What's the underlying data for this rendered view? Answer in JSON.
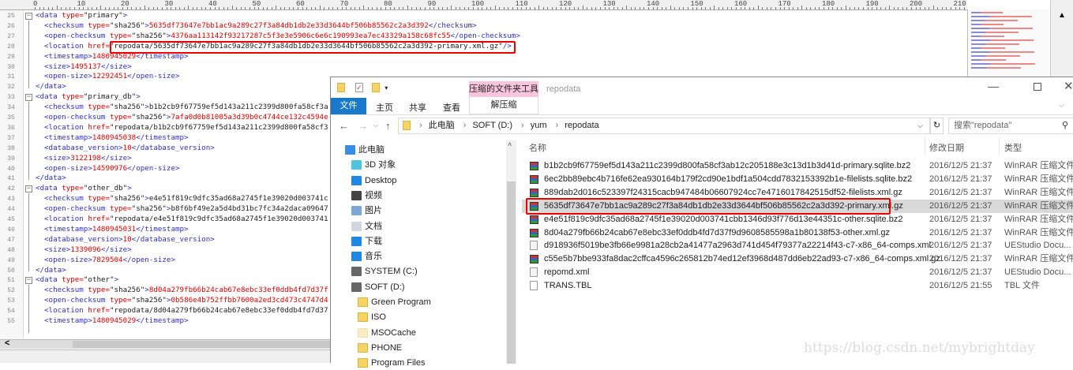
{
  "editor": {
    "ruler": [
      "0",
      "10",
      "20",
      "30",
      "40",
      "50",
      "60",
      "70",
      "80",
      "90",
      "100",
      "110",
      "120",
      "130",
      "140",
      "150",
      "160",
      "170",
      "180",
      "190",
      "200",
      "210"
    ],
    "lines": [
      {
        "n": "25",
        "i": 0,
        "t": [
          [
            "<data",
            "tag"
          ],
          [
            " type=",
            "attr"
          ],
          [
            "\"primary\"",
            "str"
          ],
          [
            ">",
            "tag"
          ]
        ]
      },
      {
        "n": "26",
        "i": 1,
        "t": [
          [
            "<checksum",
            "tag"
          ],
          [
            " type=",
            "attr"
          ],
          [
            "\"sha256\"",
            "str"
          ],
          [
            ">",
            "tag"
          ],
          [
            "5635df73647e7bb1ac9a289c27f3a84db1db2e33d3644bf506b85562c2a3d392",
            "val"
          ],
          [
            "</checksum>",
            "tag"
          ]
        ]
      },
      {
        "n": "27",
        "i": 1,
        "t": [
          [
            "<open-checksum",
            "tag"
          ],
          [
            " type=",
            "attr"
          ],
          [
            "\"sha256\"",
            "str"
          ],
          [
            ">",
            "tag"
          ],
          [
            "4376aa113142f93217287c5f3e3e5906c6e6c190993ea7ec43329a158c68fc55",
            "val"
          ],
          [
            "</open-checksum>",
            "tag"
          ]
        ]
      },
      {
        "n": "28",
        "i": 1,
        "t": [
          [
            "<location",
            "tag"
          ],
          [
            " href=",
            "attr"
          ],
          [
            "\"repodata/5635df73647e7bb1ac9a289c27f3a84db1db2e33d3644bf506b85562c2a3d392-primary.xml.gz\"",
            "str"
          ],
          [
            "/>",
            "tag"
          ]
        ]
      },
      {
        "n": "29",
        "i": 1,
        "t": [
          [
            "<timestamp>",
            "tag"
          ],
          [
            "1480945029",
            "val"
          ],
          [
            "</timestamp>",
            "tag"
          ]
        ]
      },
      {
        "n": "30",
        "i": 1,
        "t": [
          [
            "<size>",
            "tag"
          ],
          [
            "1495137",
            "val"
          ],
          [
            "</size>",
            "tag"
          ]
        ]
      },
      {
        "n": "31",
        "i": 1,
        "t": [
          [
            "<open-size>",
            "tag"
          ],
          [
            "12292451",
            "val"
          ],
          [
            "</open-size>",
            "tag"
          ]
        ]
      },
      {
        "n": "32",
        "i": 0,
        "t": [
          [
            "</data>",
            "tag"
          ]
        ]
      },
      {
        "n": "33",
        "i": 0,
        "t": [
          [
            "<data",
            "tag"
          ],
          [
            " type=",
            "attr"
          ],
          [
            "\"primary_db\"",
            "str"
          ],
          [
            ">",
            "tag"
          ]
        ]
      },
      {
        "n": "34",
        "i": 1,
        "t": [
          [
            "<checksum",
            "tag"
          ],
          [
            " type=",
            "attr"
          ],
          [
            "\"sha256\"",
            "str"
          ],
          [
            ">",
            "tag"
          ],
          [
            "b1b2cb9f67759ef5d143a211c2399d800fa58cf3a",
            "str"
          ]
        ]
      },
      {
        "n": "35",
        "i": 1,
        "t": [
          [
            "<open-checksum",
            "tag"
          ],
          [
            " type=",
            "attr"
          ],
          [
            "\"sha256\"",
            "str"
          ],
          [
            ">",
            "tag"
          ],
          [
            "7afa0d0b81005a3d39b0c4744ce132c4594e",
            "val"
          ]
        ]
      },
      {
        "n": "36",
        "i": 1,
        "t": [
          [
            "<location",
            "tag"
          ],
          [
            " href=",
            "attr"
          ],
          [
            "\"repodata/b1b2cb9f67759ef5d143a211c2399d800fa58cf3",
            "str"
          ]
        ]
      },
      {
        "n": "37",
        "i": 1,
        "t": [
          [
            "<timestamp>",
            "tag"
          ],
          [
            "1480945038",
            "val"
          ],
          [
            "</timestamp>",
            "tag"
          ]
        ]
      },
      {
        "n": "38",
        "i": 1,
        "t": [
          [
            "<database_version>",
            "tag"
          ],
          [
            "10",
            "val"
          ],
          [
            "</database_version>",
            "tag"
          ]
        ]
      },
      {
        "n": "39",
        "i": 1,
        "t": [
          [
            "<size>",
            "tag"
          ],
          [
            "3122198",
            "val"
          ],
          [
            "</size>",
            "tag"
          ]
        ]
      },
      {
        "n": "40",
        "i": 1,
        "t": [
          [
            "<open-size>",
            "tag"
          ],
          [
            "14590976",
            "val"
          ],
          [
            "</open-size>",
            "tag"
          ]
        ]
      },
      {
        "n": "41",
        "i": 0,
        "t": [
          [
            "</data>",
            "tag"
          ]
        ]
      },
      {
        "n": "42",
        "i": 0,
        "t": [
          [
            "<data",
            "tag"
          ],
          [
            " type=",
            "attr"
          ],
          [
            "\"other_db\"",
            "str"
          ],
          [
            ">",
            "tag"
          ]
        ]
      },
      {
        "n": "43",
        "i": 1,
        "t": [
          [
            "<checksum",
            "tag"
          ],
          [
            " type=",
            "attr"
          ],
          [
            "\"sha256\"",
            "str"
          ],
          [
            ">",
            "tag"
          ],
          [
            "e4e51f819c9dfc35ad68a2745f1e39020d003741c",
            "str"
          ]
        ]
      },
      {
        "n": "44",
        "i": 1,
        "t": [
          [
            "<open-checksum",
            "tag"
          ],
          [
            " type=",
            "attr"
          ],
          [
            "\"sha256\"",
            "str"
          ],
          [
            ">",
            "tag"
          ],
          [
            "b8f6bf49e2a5d4bd31bc7fc34a2daca09647",
            "str"
          ]
        ]
      },
      {
        "n": "45",
        "i": 1,
        "t": [
          [
            "<location",
            "tag"
          ],
          [
            " href=",
            "attr"
          ],
          [
            "\"repodata/e4e51f819c9dfc35ad68a2745f1e39020d003741",
            "str"
          ]
        ]
      },
      {
        "n": "46",
        "i": 1,
        "t": [
          [
            "<timestamp>",
            "tag"
          ],
          [
            "1480945031",
            "val"
          ],
          [
            "</timestamp>",
            "tag"
          ]
        ]
      },
      {
        "n": "47",
        "i": 1,
        "t": [
          [
            "<database_version>",
            "tag"
          ],
          [
            "10",
            "val"
          ],
          [
            "</database_version>",
            "tag"
          ]
        ]
      },
      {
        "n": "48",
        "i": 1,
        "t": [
          [
            "<size>",
            "tag"
          ],
          [
            "1339096",
            "val"
          ],
          [
            "</size>",
            "tag"
          ]
        ]
      },
      {
        "n": "49",
        "i": 1,
        "t": [
          [
            "<open-size>",
            "tag"
          ],
          [
            "7829504",
            "val"
          ],
          [
            "</open-size>",
            "tag"
          ]
        ]
      },
      {
        "n": "50",
        "i": 0,
        "t": [
          [
            "</data>",
            "tag"
          ]
        ]
      },
      {
        "n": "51",
        "i": 0,
        "t": [
          [
            "<data",
            "tag"
          ],
          [
            " type=",
            "attr"
          ],
          [
            "\"other\"",
            "str"
          ],
          [
            ">",
            "tag"
          ]
        ]
      },
      {
        "n": "52",
        "i": 1,
        "t": [
          [
            "<checksum",
            "tag"
          ],
          [
            " type=",
            "attr"
          ],
          [
            "\"sha256\"",
            "str"
          ],
          [
            ">",
            "tag"
          ],
          [
            "8d04a279fb66b24cab67e8ebc33ef0ddb4fd7d37f",
            "val"
          ]
        ]
      },
      {
        "n": "53",
        "i": 1,
        "t": [
          [
            "<open-checksum",
            "tag"
          ],
          [
            " type=",
            "attr"
          ],
          [
            "\"sha256\"",
            "str"
          ],
          [
            ">",
            "tag"
          ],
          [
            "0b586e4b752ffbb7600a2ed3cd473c4747d4",
            "val"
          ]
        ]
      },
      {
        "n": "54",
        "i": 1,
        "t": [
          [
            "<location",
            "tag"
          ],
          [
            " href=",
            "attr"
          ],
          [
            "\"repodata/8d04a279fb66b24cab67e8ebc33ef0ddb4fd7d37",
            "str"
          ]
        ]
      },
      {
        "n": "55",
        "i": 1,
        "t": [
          [
            "<timestamp>",
            "tag"
          ],
          [
            "1480945029",
            "val"
          ],
          [
            "</timestamp>",
            "tag"
          ]
        ]
      }
    ],
    "scroll_left": "<"
  },
  "explorer": {
    "title": "repodata",
    "context_tab": "压缩的文件夹工具",
    "tabs": [
      "文件",
      "主页",
      "共享",
      "查看"
    ],
    "context_sub_tab": "解压缩",
    "breadcrumb": [
      "此电脑",
      "SOFT (D:)",
      "yum",
      "repodata"
    ],
    "search_placeholder": "搜索\"repodata\"",
    "nav": [
      {
        "label": "此电脑",
        "icon": "pc",
        "lvl": 0
      },
      {
        "label": "3D 对象",
        "icon": "3d",
        "lvl": 1
      },
      {
        "label": "Desktop",
        "icon": "desktop",
        "lvl": 1
      },
      {
        "label": "视频",
        "icon": "video",
        "lvl": 1
      },
      {
        "label": "图片",
        "icon": "picture",
        "lvl": 1
      },
      {
        "label": "文档",
        "icon": "document",
        "lvl": 1
      },
      {
        "label": "下载",
        "icon": "download",
        "lvl": 1
      },
      {
        "label": "音乐",
        "icon": "music",
        "lvl": 1
      },
      {
        "label": "SYSTEM (C:)",
        "icon": "drive",
        "lvl": 1
      },
      {
        "label": "SOFT (D:)",
        "icon": "drive",
        "lvl": 1
      },
      {
        "label": "Green Program",
        "icon": "folder",
        "lvl": 2
      },
      {
        "label": "ISO",
        "icon": "folder",
        "lvl": 2
      },
      {
        "label": "MSOCache",
        "icon": "folder",
        "lvl": 2
      },
      {
        "label": "PHONE",
        "icon": "folder",
        "lvl": 2
      },
      {
        "label": "Program Files",
        "icon": "folder",
        "lvl": 2
      }
    ],
    "columns": {
      "name": "名称",
      "date": "修改日期",
      "type": "类型"
    },
    "files": [
      {
        "name": "b1b2cb9f67759ef5d143a211c2399d800fa58cf3ab12c205188e3c13d1b3d41d-primary.sqlite.bz2",
        "date": "2016/12/5 21:37",
        "type": "WinRAR 压缩文件",
        "icon": "rar"
      },
      {
        "name": "6ec2bb89ebc4b716fe62ea930164b179f2cd90e1bdf1a504cdd7832153392b1e-filelists.sqlite.bz2",
        "date": "2016/12/5 21:37",
        "type": "WinRAR 压缩文件",
        "icon": "rar"
      },
      {
        "name": "889dab2d016c523397f24315cacb947484b06607924cc7e4716017842515df52-filelists.xml.gz",
        "date": "2016/12/5 21:37",
        "type": "WinRAR 压缩文件",
        "icon": "rar"
      },
      {
        "name": "5635df73647e7bb1ac9a289c27f3a84db1db2e33d3644bf506b85562c2a3d392-primary.xml.gz",
        "date": "2016/12/5 21:37",
        "type": "WinRAR 压缩文件",
        "icon": "rar",
        "selected": true
      },
      {
        "name": "e4e51f819c9dfc35ad68a2745f1e39020d003741cbb1346d93f776d13e44351c-other.sqlite.bz2",
        "date": "2016/12/5 21:37",
        "type": "WinRAR 压缩文件",
        "icon": "rar"
      },
      {
        "name": "8d04a279fb66b24cab67e8ebc33ef0ddb4fd7d37f9d9608585598a1b80138f53-other.xml.gz",
        "date": "2016/12/5 21:37",
        "type": "WinRAR 压缩文件",
        "icon": "rar"
      },
      {
        "name": "d918936f5019be3fb66e9981a28cb2a41477a2963d741d454f79377a22214f43-c7-x86_64-comps.xml",
        "date": "2016/12/5 21:37",
        "type": "UEStudio Docu...",
        "icon": "xml"
      },
      {
        "name": "c55e5b7bbe933fa8dac2cffca4596c265812b74ed12ef3968d487dd6eb22ad93-c7-x86_64-comps.xml.gz",
        "date": "2016/12/5 21:37",
        "type": "WinRAR 压缩文件",
        "icon": "rar"
      },
      {
        "name": "repomd.xml",
        "date": "2016/12/5 21:37",
        "type": "UEStudio Docu...",
        "icon": "xml"
      },
      {
        "name": "TRANS.TBL",
        "date": "2016/12/5 21:55",
        "type": "TBL 文件",
        "icon": "doc"
      }
    ]
  },
  "watermark": "https://blog.csdn.net/mybrightday",
  "colors": {
    "tag": "#3030c8",
    "attr": "#e00000",
    "highlight": "#e00000",
    "file_tab": "#1979ca",
    "context_tab": "#f9c5dc"
  }
}
